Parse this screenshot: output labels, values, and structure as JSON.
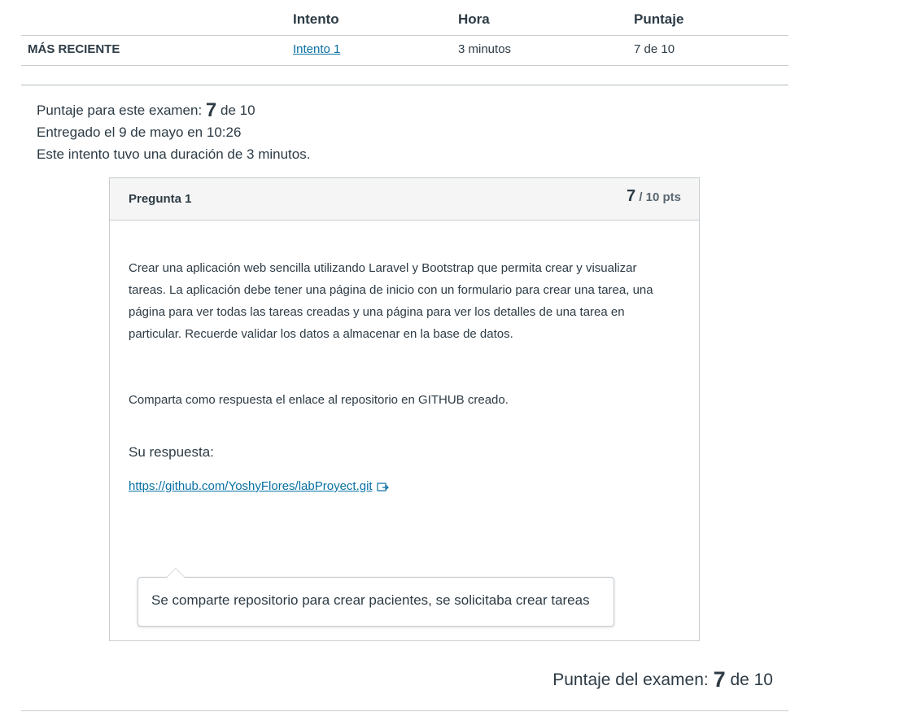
{
  "attempts_table": {
    "headers": [
      "Intento",
      "Hora",
      "Puntaje"
    ],
    "row": {
      "label": "MÁS RECIENTE",
      "attempt": "Intento 1",
      "time": "3 minutos",
      "score": "7 de 10"
    }
  },
  "summary": {
    "score_prefix": "Puntaje para este examen:",
    "score_value": "7",
    "score_suffix": "de 10",
    "submitted": "Entregado el 9 de mayo en 10:26",
    "duration": "Este intento tuvo una duración de 3 minutos."
  },
  "question": {
    "title": "Pregunta 1",
    "points_score": "7",
    "points_total": "/ 10 pts",
    "text_lines": [
      "Crear una aplicación web sencilla utilizando Laravel y Bootstrap que permita  crear y visualizar",
      "tareas. La aplicación debe tener una página de inicio con un formulario para crear una tarea, una",
      "página para ver todas las tareas creadas y una página para ver los detalles de una tarea en",
      "particular. Recuerde validar los datos a almacenar en la base de datos."
    ],
    "instruction": "Comparta como respuesta el enlace al repositorio en GITHUB creado.",
    "answer_label": "Su respuesta:",
    "answer_link": "https://github.com/YoshyFlores/labProyect.git",
    "answer_link_icon": "external-link-icon",
    "comment": "Se comparte repositorio para crear pacientes, se solicitaba crear tareas"
  },
  "final_score": {
    "prefix": "Puntaje del examen:",
    "value": "7",
    "suffix": "de 10"
  },
  "colors": {
    "text": "#2d3b45",
    "link": "#0770a3",
    "border": "#c7cdd1",
    "header_bg": "#f5f5f5"
  }
}
